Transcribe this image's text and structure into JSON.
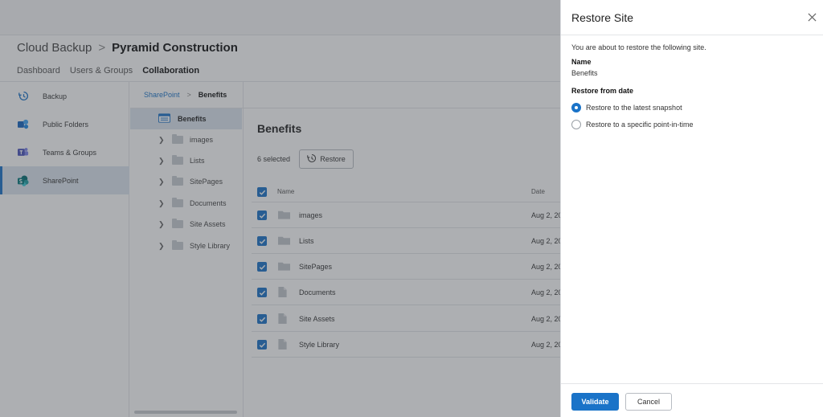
{
  "header": {
    "breadcrumb_root": "Cloud Backup",
    "breadcrumb_sep": ">",
    "breadcrumb_current": "Pyramid Construction",
    "tabs": [
      {
        "label": "Dashboard"
      },
      {
        "label": "Users & Groups"
      },
      {
        "label": "Collaboration"
      }
    ]
  },
  "sidebar": {
    "items": [
      {
        "label": "Backup",
        "icon": "history-icon"
      },
      {
        "label": "Public Folders",
        "icon": "public-folders-icon"
      },
      {
        "label": "Teams & Groups",
        "icon": "teams-icon"
      },
      {
        "label": "SharePoint",
        "icon": "sharepoint-icon"
      }
    ]
  },
  "tree": {
    "breadcrumb_link": "SharePoint",
    "breadcrumb_sep": ">",
    "breadcrumb_current": "Benefits",
    "root_label": "Benefits",
    "items": [
      {
        "label": "images"
      },
      {
        "label": "Lists"
      },
      {
        "label": "SitePages"
      },
      {
        "label": "Documents"
      },
      {
        "label": "Site Assets"
      },
      {
        "label": "Style Library"
      }
    ]
  },
  "main": {
    "title": "Benefits",
    "selected_count": "6 selected",
    "restore_label": "Restore",
    "col_name": "Name",
    "col_date": "Date",
    "rows": [
      {
        "name": "images",
        "date": "Aug 2, 20",
        "type": "folder"
      },
      {
        "name": "Lists",
        "date": "Aug 2, 20",
        "type": "folder"
      },
      {
        "name": "SitePages",
        "date": "Aug 2, 20",
        "type": "folder"
      },
      {
        "name": "Documents",
        "date": "Aug 2, 20",
        "type": "file"
      },
      {
        "name": "Site Assets",
        "date": "Aug 2, 20",
        "type": "file"
      },
      {
        "name": "Style Library",
        "date": "Aug 2, 20",
        "type": "file"
      }
    ]
  },
  "panel": {
    "title": "Restore Site",
    "intro": "You are about to restore the following site.",
    "name_label": "Name",
    "name_value": "Benefits",
    "date_label": "Restore from date",
    "options": [
      {
        "label": "Restore to the latest snapshot",
        "selected": true
      },
      {
        "label": "Restore to a specific point-in-time",
        "selected": false
      }
    ],
    "validate_label": "Validate",
    "cancel_label": "Cancel"
  },
  "colors": {
    "accent": "#1a73c8",
    "overlay": "#3c4048"
  }
}
